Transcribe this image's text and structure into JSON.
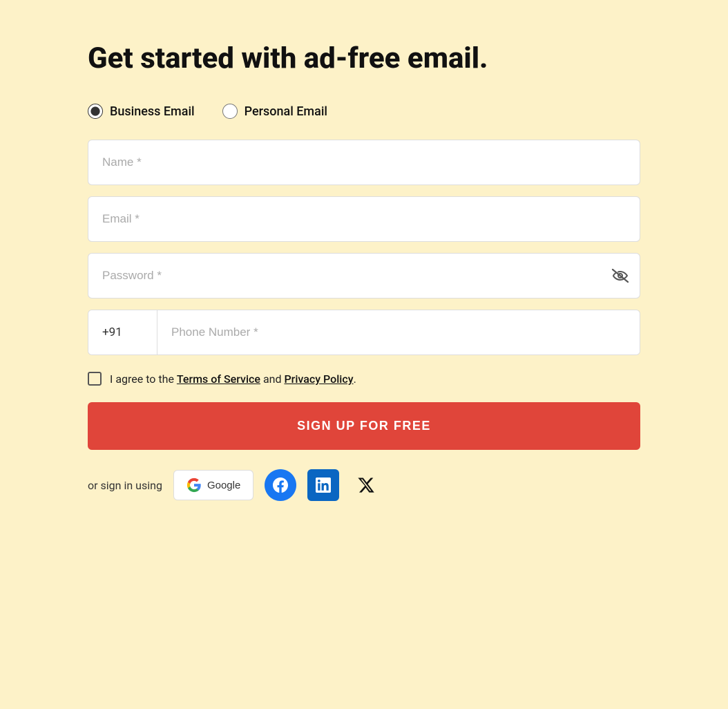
{
  "page": {
    "background_color": "#fdf2c8"
  },
  "header": {
    "title": "Get started with ad-free email."
  },
  "email_type": {
    "options": [
      {
        "id": "business",
        "label": "Business Email",
        "checked": true
      },
      {
        "id": "personal",
        "label": "Personal Email",
        "checked": false
      }
    ]
  },
  "form": {
    "name_placeholder": "Name *",
    "email_placeholder": "Email *",
    "password_placeholder": "Password *",
    "phone_code": "+91",
    "phone_placeholder": "Phone Number *",
    "terms_text_before": "I agree to the ",
    "terms_link1": "Terms of Service",
    "terms_text_middle": " and ",
    "terms_link2": "Privacy Policy",
    "terms_text_after": ".",
    "signup_button_label": "SIGN UP FOR FREE"
  },
  "social": {
    "text": "or sign in using",
    "google_label": "Google",
    "facebook_label": "f",
    "linkedin_label": "in",
    "twitter_label": "X"
  }
}
